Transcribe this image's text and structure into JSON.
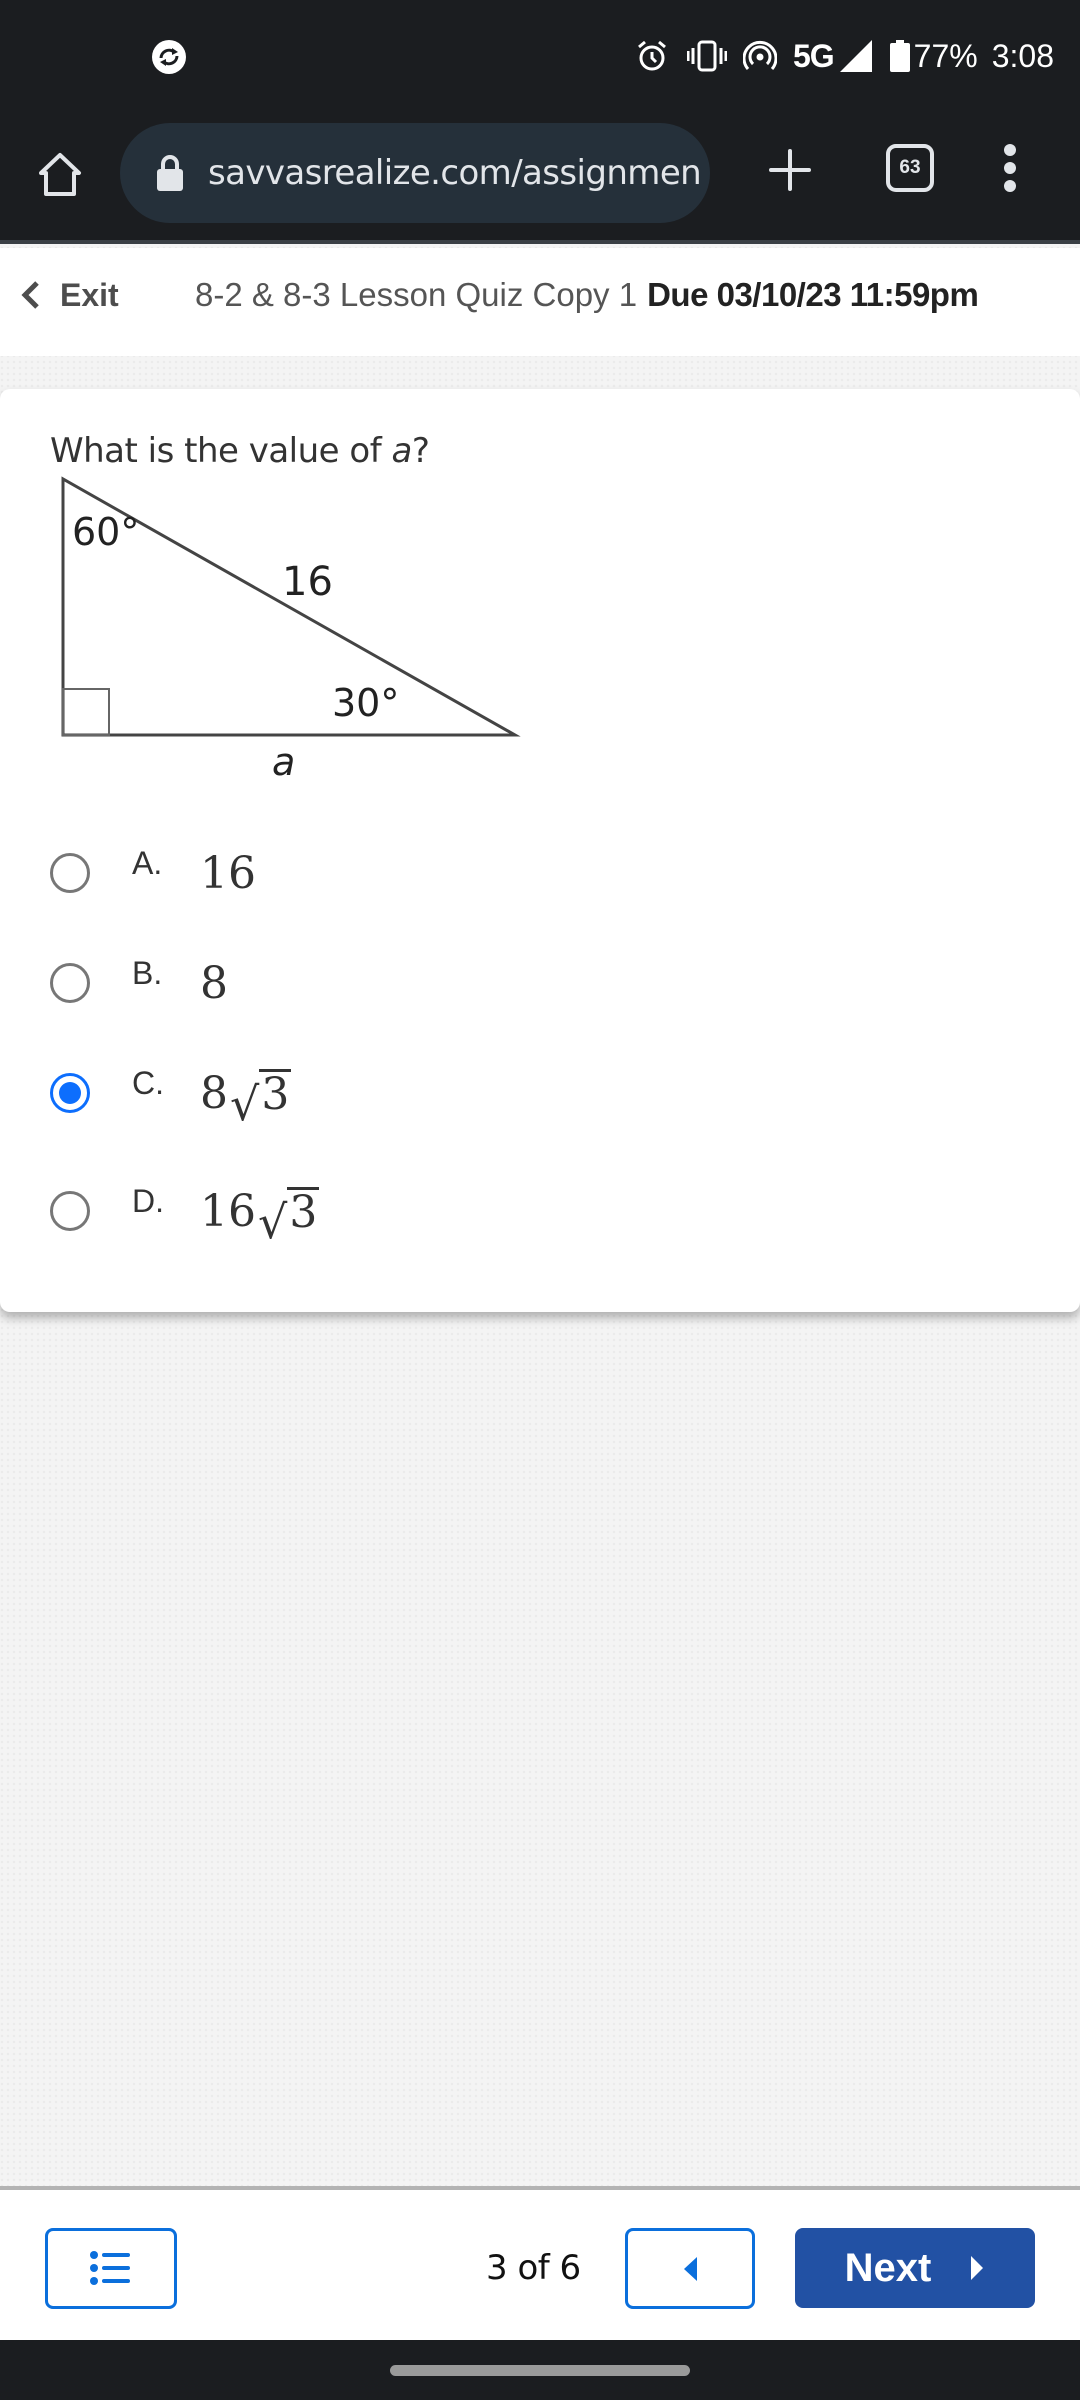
{
  "status_bar": {
    "left_icons": [
      "sync-icon"
    ],
    "right_icons": [
      "alarm-icon",
      "vibrate-icon",
      "hotspot-icon",
      "signal-icon",
      "battery-icon"
    ],
    "network": "5G",
    "battery": "77%",
    "time": "3:08"
  },
  "browser": {
    "url": "savvasrealize.com/assignmen",
    "tab_count": "63",
    "icons": [
      "home-icon",
      "lock-icon",
      "plus-icon",
      "tabs-icon",
      "more-vert-icon"
    ]
  },
  "quiz_header": {
    "exit_label": "Exit",
    "quiz_name": "8-2 & 8-3 Lesson Quiz Copy 1",
    "due": "Due 03/10/23 11:59pm"
  },
  "question": {
    "prompt_prefix": "What is the value of ",
    "prompt_variable": "a",
    "prompt_suffix": "?",
    "diagram": {
      "type": "right-triangle",
      "top_angle": "60°",
      "bottom_right_angle": "30°",
      "hypotenuse": "16",
      "bottom_side": "a",
      "right_angle_at": "bottom-left"
    },
    "choices": [
      {
        "letter": "A.",
        "coef": "16",
        "radicand": null,
        "selected": false
      },
      {
        "letter": "B.",
        "coef": "8",
        "radicand": null,
        "selected": false
      },
      {
        "letter": "C.",
        "coef": "8",
        "radicand": "3",
        "selected": true
      },
      {
        "letter": "D.",
        "coef": "16",
        "radicand": "3",
        "selected": false
      }
    ]
  },
  "bottom_nav": {
    "page_indicator": "3 of 6",
    "next_label": "Next",
    "accent_color": "#0b6fdc",
    "next_color": "#2251a4"
  },
  "colors": {
    "selected_radio": "#0d6efd",
    "chrome_dark": "#1b1d20",
    "url_pill": "#25303a"
  }
}
